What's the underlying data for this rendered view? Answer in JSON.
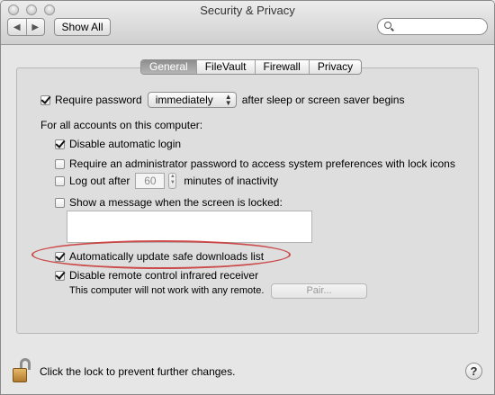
{
  "window": {
    "title": "Security & Privacy"
  },
  "toolbar": {
    "back_glyph": "◀",
    "forward_glyph": "▶",
    "show_all_label": "Show All",
    "search_placeholder": ""
  },
  "tabs": [
    {
      "label": "General",
      "active": true
    },
    {
      "label": "FileVault",
      "active": false
    },
    {
      "label": "Firewall",
      "active": false
    },
    {
      "label": "Privacy",
      "active": false
    }
  ],
  "general": {
    "require_password": {
      "label": "Require password",
      "checked": true
    },
    "require_password_popup": "immediately",
    "require_password_suffix": "after sleep or screen saver begins",
    "all_accounts_heading": "For all accounts on this computer:",
    "disable_auto_login": {
      "label": "Disable automatic login",
      "checked": true
    },
    "require_admin_pw": {
      "label": "Require an administrator password to access system preferences with lock icons",
      "checked": false
    },
    "log_out_after": {
      "label": "Log out after",
      "checked": false,
      "value": "60",
      "suffix": "minutes of inactivity"
    },
    "show_message": {
      "label": "Show a message when the screen is locked:",
      "checked": false,
      "message": ""
    },
    "auto_update_safe_downloads": {
      "label": "Automatically update safe downloads list",
      "checked": true
    },
    "disable_ir_receiver": {
      "label": "Disable remote control infrared receiver",
      "checked": true
    },
    "ir_note": "This computer will not work with any remote.",
    "pair_button_label": "Pair..."
  },
  "footer": {
    "lock_text": "Click the lock to prevent further changes.",
    "help_label": "?"
  },
  "colors": {
    "annotation_ellipse": "#c93a3a",
    "active_tab": "#9e9e9e"
  }
}
